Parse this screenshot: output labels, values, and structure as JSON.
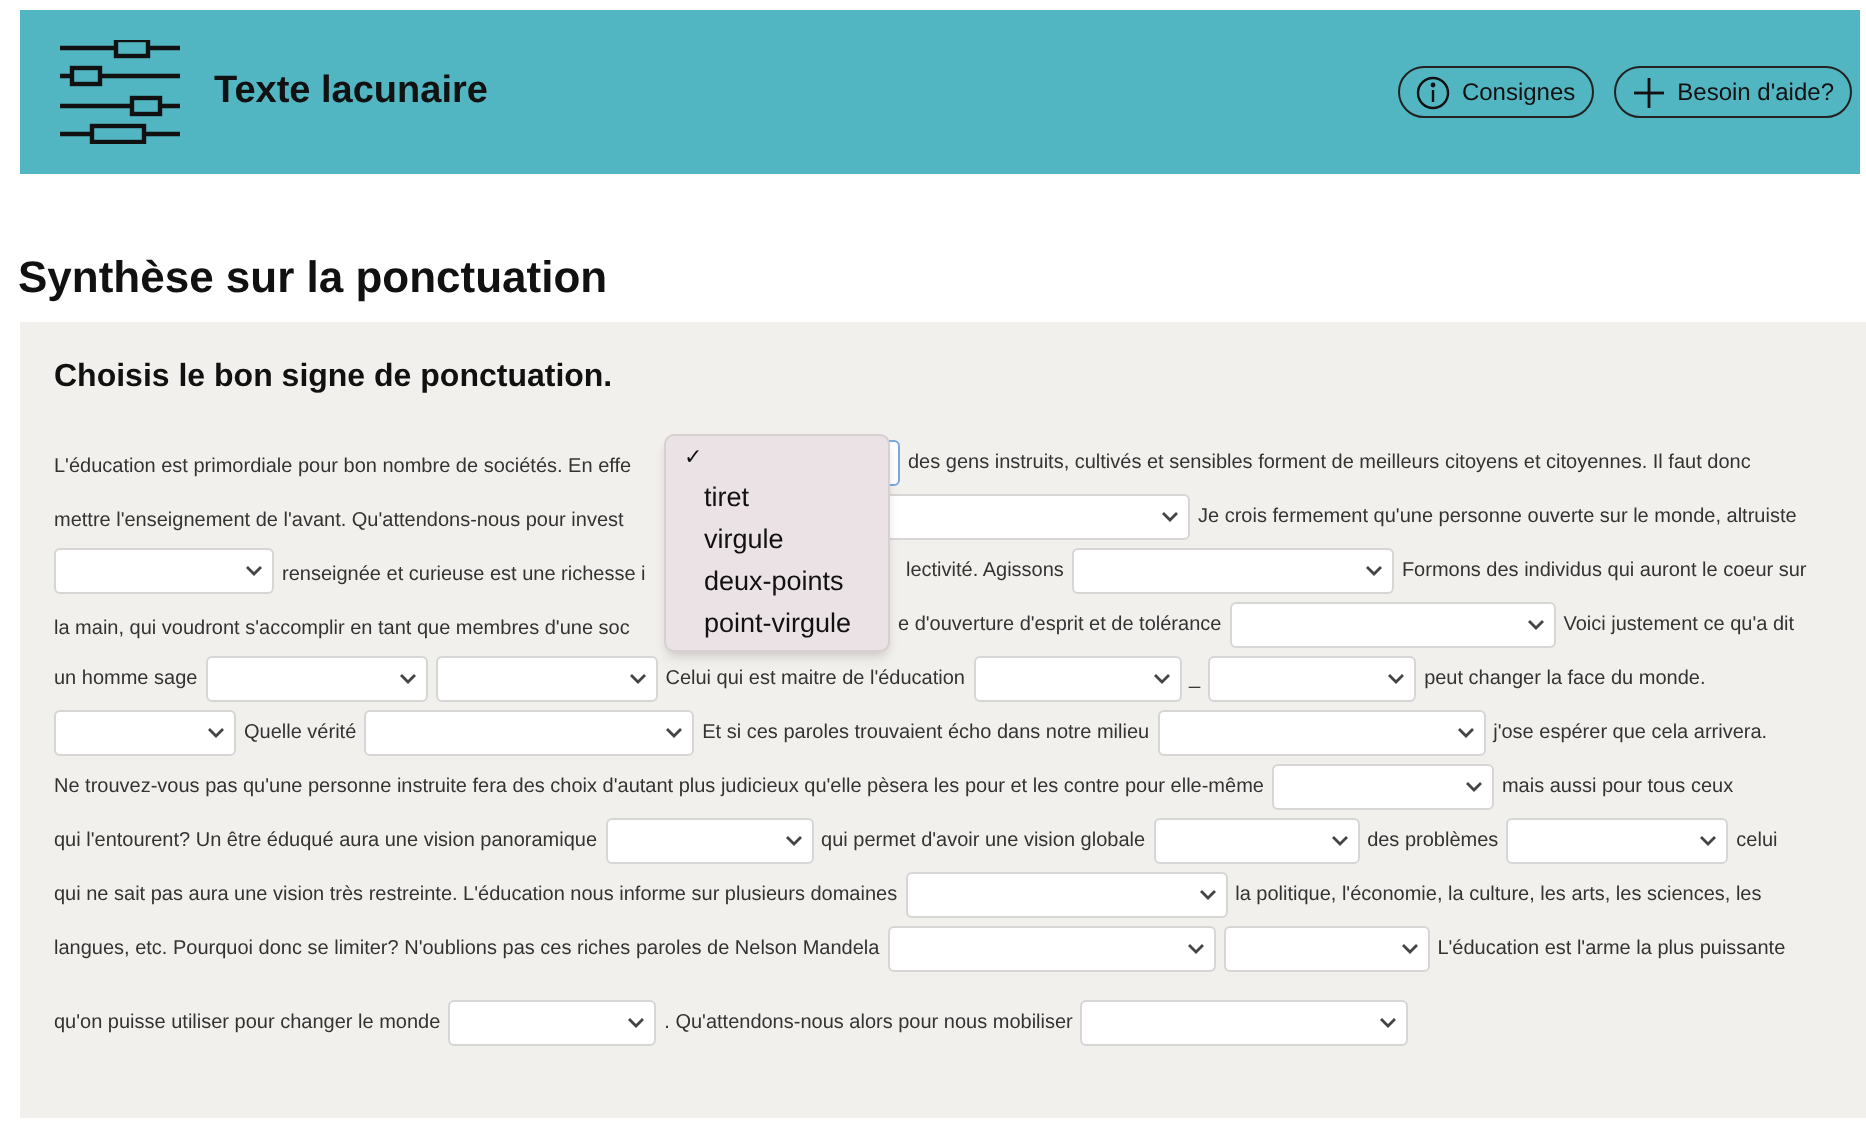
{
  "header": {
    "title": "Texte lacunaire",
    "buttons": [
      {
        "kind": "info",
        "label": "Consignes"
      },
      {
        "kind": "help",
        "label": "Besoin d'aide?"
      }
    ]
  },
  "page_title": "Synthèse sur la ponctuation",
  "exercise": {
    "instruction": "Choisis le bon signe de ponctuation.",
    "lines": [
      {
        "segments": [
          {
            "kind": "text",
            "text": "L'éducation est primordiale pour bon nombre de sociétés. En effe"
          },
          {
            "kind": "select",
            "open": true
          },
          {
            "kind": "text",
            "text": "des gens instruits, cultivés et sensibles forment de meilleurs citoyens et citoyennes. Il faut donc"
          }
        ]
      },
      {
        "segments": [
          {
            "kind": "text",
            "text": "mettre l'enseignement de l'avant. Qu'attendons-nous pour invest"
          },
          {
            "kind": "select",
            "open": false
          },
          {
            "kind": "text",
            "text": "Je crois fermement qu'une personne ouverte sur le monde, altruiste"
          }
        ]
      },
      {
        "segments": [
          {
            "kind": "select",
            "open": false
          },
          {
            "kind": "text",
            "text": "renseignée et curieuse est une richesse i"
          },
          {
            "kind": "text",
            "text": "lectivité. Agissons"
          },
          {
            "kind": "select",
            "open": false
          },
          {
            "kind": "text",
            "text": "Formons des individus qui auront le coeur sur"
          }
        ]
      },
      {
        "segments": [
          {
            "kind": "text",
            "text": "la main, qui voudront s'accomplir en tant que membres d'une soc"
          },
          {
            "kind": "text",
            "text": "e d'ouverture d'esprit et de tolérance"
          },
          {
            "kind": "select",
            "open": false
          },
          {
            "kind": "text",
            "text": "Voici justement ce qu'a dit"
          }
        ]
      },
      {
        "segments": [
          {
            "kind": "text",
            "text": "un homme sage"
          },
          {
            "kind": "select",
            "open": false
          },
          {
            "kind": "select",
            "open": false
          },
          {
            "kind": "text",
            "text": "Celui qui est maitre de l'éducation"
          },
          {
            "kind": "select",
            "open": false
          },
          {
            "kind": "text",
            "text": "_"
          },
          {
            "kind": "select",
            "open": false
          },
          {
            "kind": "text",
            "text": "peut changer la face du monde."
          }
        ]
      },
      {
        "segments": [
          {
            "kind": "select",
            "open": false
          },
          {
            "kind": "text",
            "text": "Quelle vérité"
          },
          {
            "kind": "select",
            "open": false
          },
          {
            "kind": "text",
            "text": "Et si ces paroles trouvaient écho dans notre milieu"
          },
          {
            "kind": "select",
            "open": false
          },
          {
            "kind": "text",
            "text": "j'ose espérer que cela arrivera."
          }
        ]
      },
      {
        "segments": [
          {
            "kind": "text",
            "text": "Ne trouvez-vous pas qu'une personne instruite fera des choix d'autant plus judicieux qu'elle pèsera les pour et les contre pour elle-même"
          },
          {
            "kind": "select",
            "open": false
          },
          {
            "kind": "text",
            "text": "mais aussi pour tous ceux"
          }
        ]
      },
      {
        "segments": [
          {
            "kind": "text",
            "text": "qui l'entourent? Un être éduqué aura une vision panoramique"
          },
          {
            "kind": "select",
            "open": false
          },
          {
            "kind": "text",
            "text": "qui permet d'avoir une vision globale"
          },
          {
            "kind": "select",
            "open": false
          },
          {
            "kind": "text",
            "text": "des problèmes"
          },
          {
            "kind": "select",
            "open": false
          },
          {
            "kind": "text",
            "text": "celui"
          }
        ]
      },
      {
        "segments": [
          {
            "kind": "text",
            "text": "qui ne sait pas aura une vision très restreinte. L'éducation nous informe sur plusieurs domaines"
          },
          {
            "kind": "select",
            "open": false
          },
          {
            "kind": "text",
            "text": "la politique, l'économie, la culture, les arts, les sciences, les"
          }
        ]
      },
      {
        "segments": [
          {
            "kind": "text",
            "text": "langues, etc. Pourquoi donc se limiter? N'oublions pas ces riches paroles de Nelson Mandela"
          },
          {
            "kind": "select",
            "open": false
          },
          {
            "kind": "select",
            "open": false
          },
          {
            "kind": "text",
            "text": "L'éducation est l'arme la plus puissante"
          }
        ]
      },
      {
        "segments": [
          {
            "kind": "text",
            "text": "qu'on puisse utiliser pour changer le monde"
          },
          {
            "kind": "select",
            "open": false
          },
          {
            "kind": "text",
            "text": ". Qu'attendons-nous alors pour nous mobiliser"
          },
          {
            "kind": "select",
            "open": false
          }
        ]
      }
    ]
  },
  "dropdown_menu": {
    "blank_option": {
      "mark": "✓",
      "selected": true
    },
    "options": [
      {
        "label": "tiret",
        "selected": false
      },
      {
        "label": "virgule",
        "selected": false
      },
      {
        "label": "deux-points",
        "selected": false
      },
      {
        "label": "point-virgule",
        "selected": false
      }
    ]
  }
}
